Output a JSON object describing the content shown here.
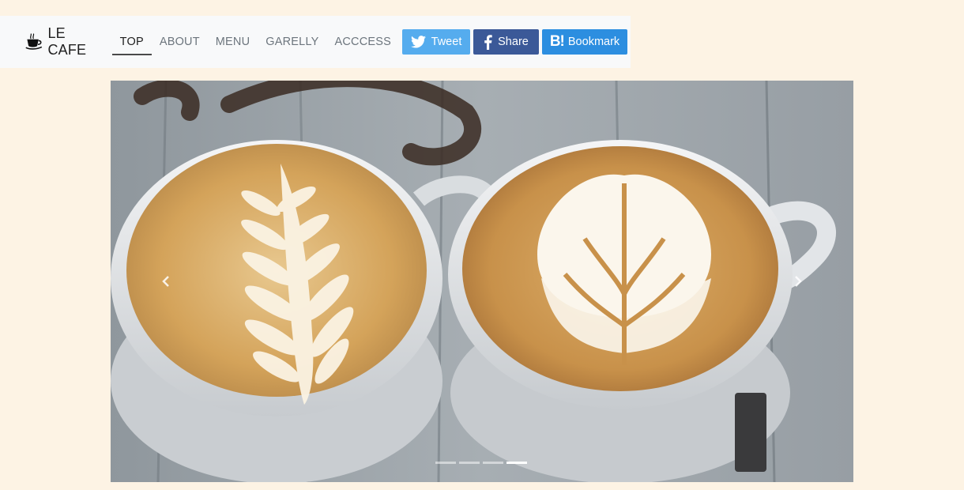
{
  "brand": {
    "name": "LE CAFE",
    "icon": "coffee-cup-icon"
  },
  "nav": {
    "items": [
      {
        "label": "TOP",
        "active": true
      },
      {
        "label": "ABOUT",
        "active": false
      },
      {
        "label": "MENU",
        "active": false
      },
      {
        "label": "GARELLY",
        "active": false
      },
      {
        "label": "ACCCESS",
        "active": false
      }
    ]
  },
  "share": {
    "tweet": {
      "label": "Tweet",
      "icon": "twitter-bird-icon",
      "color": "#55acee"
    },
    "facebook": {
      "label": "Share",
      "icon": "facebook-f-icon",
      "color": "#3b5998"
    },
    "hatena": {
      "label": "Bookmark",
      "icon": "hatena-b-icon",
      "icon_text": "B!",
      "color": "#2c8ee0"
    }
  },
  "carousel": {
    "slide_count": 4,
    "active_index": 3,
    "prev_icon": "chevron-left-icon",
    "next_icon": "chevron-right-icon"
  },
  "colors": {
    "page_background": "#fdf3e4",
    "navbar_background": "#f8f9fa"
  }
}
